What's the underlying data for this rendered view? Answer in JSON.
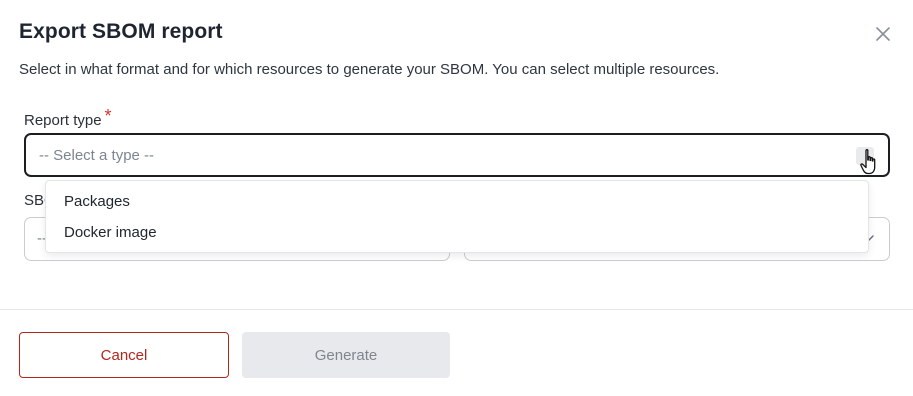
{
  "dialog": {
    "title": "Export SBOM report",
    "subtitle": "Select in what format and for which resources to generate your SBOM. You can select multiple resources."
  },
  "report_type": {
    "label": "Report type",
    "required_mark": "*",
    "placeholder": "-- Select a type --",
    "options": [
      "Packages",
      "Docker image"
    ]
  },
  "sbom_field": {
    "label_partial": "SBO",
    "left_placeholder_partial": "--"
  },
  "footer": {
    "cancel_label": "Cancel",
    "generate_label": "Generate"
  },
  "icons": {
    "close": "close-icon",
    "chevron": "chevron-down-icon",
    "cursor": "hand-pointer-cursor"
  },
  "colors": {
    "danger": "#b3261e",
    "required": "#d0342c",
    "disabled_bg": "#e8e9ec",
    "active_border": "#1b1f24"
  }
}
